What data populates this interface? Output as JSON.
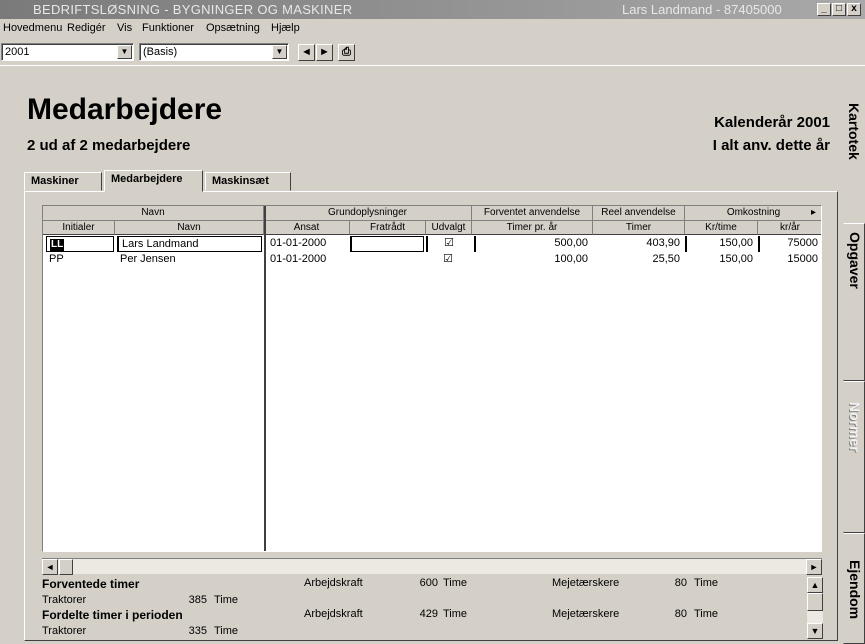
{
  "window": {
    "title": "BEDRIFTSLØSNING - BYGNINGER OG MASKINER",
    "user": "Lars Landmand - 87405000",
    "minimize": "_",
    "maximize": "□",
    "close": "x"
  },
  "menu": {
    "items": [
      "Hovedmenu",
      "Redigér",
      "Vis",
      "Funktioner",
      "Opsætning",
      "Hjælp"
    ]
  },
  "toolbar": {
    "year": "2001",
    "scenario": "(Basis)",
    "back_glyph": "◄",
    "forward_glyph": "►",
    "print_glyph": "⎙",
    "dropdown_glyph": "▼"
  },
  "page": {
    "title": "Medarbejdere",
    "subtitle": "2 ud af 2 medarbejdere",
    "calendar_year": "Kalenderår 2001",
    "total_use": "I alt anv. dette år"
  },
  "tabs": [
    {
      "label": "Maskiner"
    },
    {
      "label": "Medarbejdere"
    },
    {
      "label": "Maskinsæt"
    }
  ],
  "grid": {
    "group_headers": [
      "Navn",
      "Grundoplysninger",
      "Forventet anvendelse",
      "Reel anvendelse",
      "Omkostning"
    ],
    "group_scroll_glyph": "▸",
    "columns": [
      "Initialer",
      "Navn",
      "Ansat",
      "Fratrådt",
      "Udvalgt",
      "Timer pr. år",
      "Timer",
      "Kr/time",
      "kr/år"
    ],
    "rows": [
      {
        "initials": "LL",
        "name": "Lars Landmand",
        "hired": "01-01-2000",
        "resigned": "",
        "selected": "☑",
        "expected_hours": "500,00",
        "real_hours": "403,90",
        "rate": "150,00",
        "yearly": "75000"
      },
      {
        "initials": "PP",
        "name": "Per Jensen",
        "hired": "01-01-2000",
        "resigned": "",
        "selected": "☑",
        "expected_hours": "100,00",
        "real_hours": "25,50",
        "rate": "150,00",
        "yearly": "15000"
      }
    ]
  },
  "scroll": {
    "left": "◄",
    "right": "►",
    "up": "▲",
    "down": "▼"
  },
  "summary": {
    "expected_label": "Forventede timer",
    "distributed_label": "Fordelte timer i perioden",
    "expected": [
      {
        "name": "Traktorer",
        "value": "385",
        "unit": "Time"
      },
      {
        "name": "Arbejdskraft",
        "value": "600",
        "unit": "Time"
      },
      {
        "name": "Mejetærskere",
        "value": "80",
        "unit": "Time"
      }
    ],
    "distributed": [
      {
        "name": "Traktorer",
        "value": "335",
        "unit": "Time"
      },
      {
        "name": "Arbejdskraft",
        "value": "429",
        "unit": "Time"
      },
      {
        "name": "Mejetærskere",
        "value": "80",
        "unit": "Time"
      }
    ]
  },
  "side_tabs": [
    {
      "label": "Kartotek"
    },
    {
      "label": "Opgaver"
    },
    {
      "label": "Normer"
    },
    {
      "label": "Ejendom"
    }
  ]
}
